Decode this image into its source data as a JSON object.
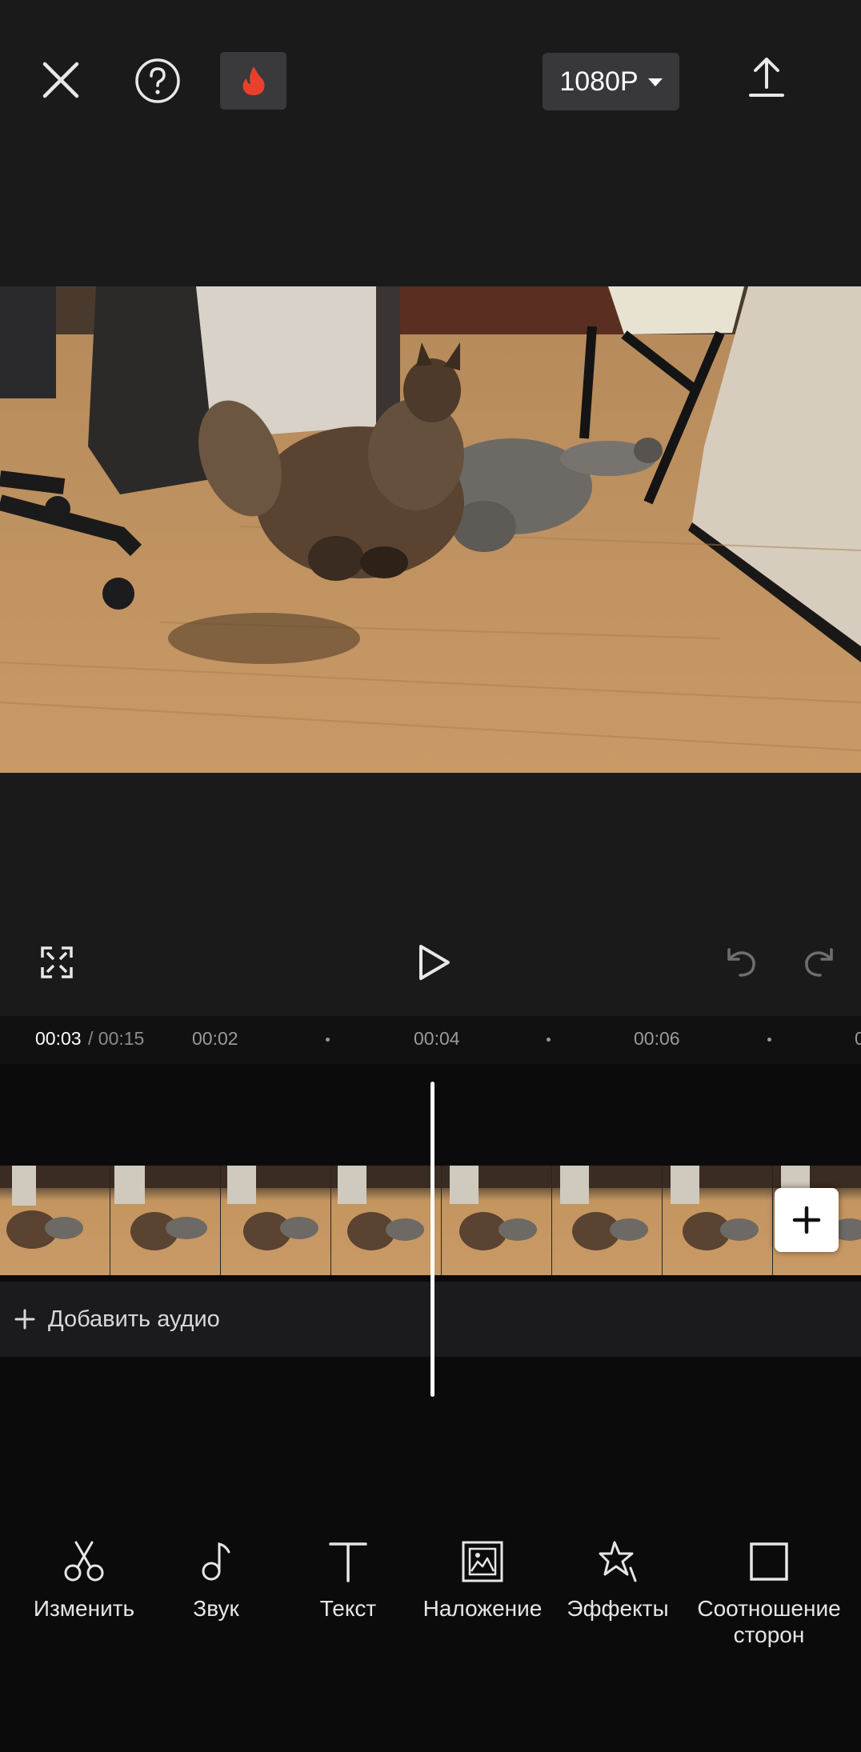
{
  "header": {
    "resolution_label": "1080P",
    "icons": {
      "close": "close-icon",
      "help": "help-icon",
      "fire": "fire-icon",
      "export": "upload-icon"
    },
    "fire_color": "#e8402c"
  },
  "playback": {
    "icons": [
      "fullscreen-icon",
      "play-icon",
      "undo-icon",
      "redo-icon"
    ]
  },
  "timeline": {
    "current_time": "00:03",
    "total_time": "/ 00:15",
    "ruler_labels": [
      "00:02",
      "00:04",
      "00:06",
      "0"
    ],
    "add_audio_label": "Добавить аудио"
  },
  "toolbar": {
    "items": [
      {
        "label": "Изменить",
        "icon": "scissors-icon"
      },
      {
        "label": "Звук",
        "icon": "music-note-icon"
      },
      {
        "label": "Текст",
        "icon": "text-icon"
      },
      {
        "label": "Наложение",
        "icon": "overlay-icon"
      },
      {
        "label": "Эффекты",
        "icon": "effects-star-icon"
      },
      {
        "label": "Соотношение\nсторон",
        "icon": "aspect-ratio-icon"
      }
    ]
  },
  "colors": {
    "background": "#141414",
    "panel": "#1a1a1b",
    "timeline_bg": "#0b0b0c",
    "accent_white": "#ffffff"
  }
}
